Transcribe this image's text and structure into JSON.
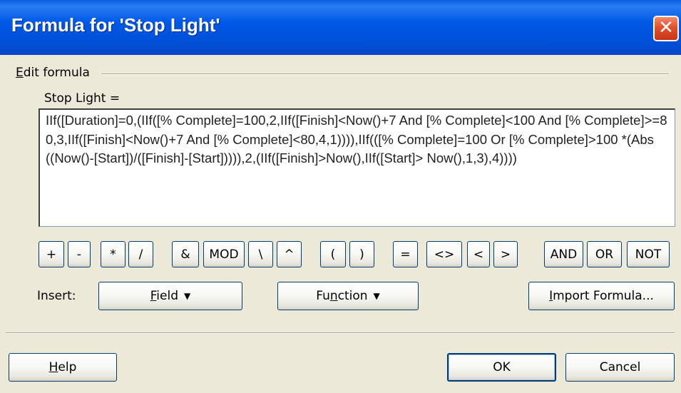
{
  "window": {
    "title": "Formula for 'Stop Light'",
    "close_glyph": "✕"
  },
  "section": {
    "label_prefix": "",
    "label_accel": "E",
    "label_rest": "dit formula"
  },
  "field": {
    "label": "Stop Light ="
  },
  "formula": {
    "value": "IIf([Duration]=0,(IIf([% Complete]=100,2,IIf([Finish]<Now()+7 And [% Complete]<100 And [% Complete]>=80,3,IIf([Finish]<Now()+7 And [% Complete]<80,4,1)))),IIf(([% Complete]=100 Or [% Complete]>100 *(Abs((Now()-[Start])/([Finish]-[Start])))),2,(IIf([Finish]>Now(),IIf([Start]> Now(),1,3),4))))"
  },
  "operators": [
    "+",
    "-",
    "*",
    "/",
    "&",
    "MOD",
    "\\",
    "^",
    "(",
    ")",
    "=",
    "<>",
    "<",
    ">",
    "AND",
    "OR",
    "NOT"
  ],
  "insert": {
    "label": "Insert:",
    "field_accel": "F",
    "field_rest": "ield",
    "function_pre": "Fu",
    "function_accel": "n",
    "function_rest": "ction",
    "import_accel": "I",
    "import_rest": "mport Formula..."
  },
  "footer": {
    "help_accel": "H",
    "help_rest": "elp",
    "ok_label": "OK",
    "cancel_label": "Cancel"
  },
  "icons": {
    "dropdown": "caret-down-icon",
    "close": "close-icon"
  }
}
